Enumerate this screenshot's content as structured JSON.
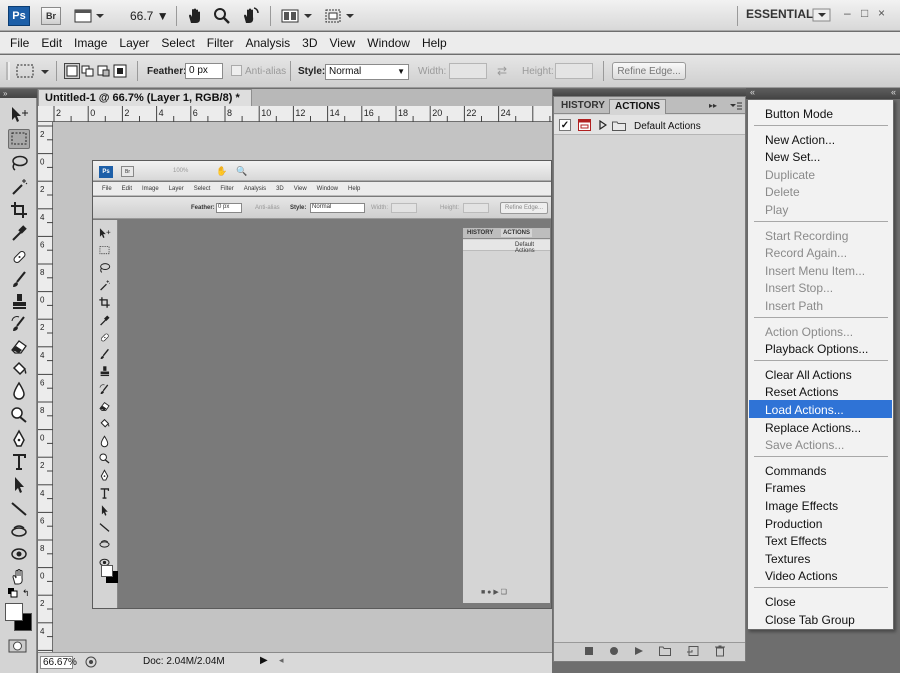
{
  "app": {
    "ps_label": "Ps",
    "br_label": "Br",
    "zoom_label": "66.7 ▼",
    "workspace_label": "ESSENTIALS"
  },
  "menubar": [
    "File",
    "Edit",
    "Image",
    "Layer",
    "Select",
    "Filter",
    "Analysis",
    "3D",
    "View",
    "Window",
    "Help"
  ],
  "options": {
    "feather_label": "Feather:",
    "feather_value": "0 px",
    "antialias_label": "Anti-alias",
    "style_label": "Style:",
    "style_value": "Normal",
    "width_label": "Width:",
    "height_label": "Height:",
    "refine_label": "Refine Edge..."
  },
  "document": {
    "tab_title": "Untitled-1 @ 66.7% (Layer 1, RGB/8) *",
    "close_glyph": "×"
  },
  "ruler_h": [
    "2",
    "0",
    "2",
    "4",
    "6",
    "8",
    "10",
    "12",
    "14",
    "16",
    "18",
    "20",
    "22",
    "24"
  ],
  "ruler_v": [
    "2",
    "0",
    "2",
    "4",
    "6",
    "8",
    "0",
    "2",
    "4",
    "6",
    "8",
    "0",
    "2",
    "4",
    "6",
    "8",
    "0",
    "2",
    "4"
  ],
  "status": {
    "zoom": "66.67%",
    "doc": "Doc: 2.04M/2.04M"
  },
  "panel": {
    "tab_history": "HISTORY",
    "tab_actions": "ACTIONS",
    "action_set": "Default Actions"
  },
  "inner": {
    "zoom": "100%",
    "menubar": [
      "File",
      "Edit",
      "Image",
      "Layer",
      "Select",
      "Filter",
      "Analysis",
      "3D",
      "View",
      "Window",
      "Help"
    ],
    "feather_label": "Feather:",
    "feather_value": "0 px",
    "antialias_label": "Anti-alias",
    "style_label": "Style:",
    "style_value": "Normal",
    "width_label": "Width:",
    "height_label": "Height:",
    "refine_label": "Refine Edge...",
    "tab_history": "HISTORY",
    "tab_actions": "ACTIONS",
    "action_set": "Default Actions"
  },
  "menu": {
    "groups": [
      [
        {
          "label": "Button Mode",
          "enabled": true
        }
      ],
      [
        {
          "label": "New Action...",
          "enabled": true
        },
        {
          "label": "New Set...",
          "enabled": true
        },
        {
          "label": "Duplicate",
          "enabled": false
        },
        {
          "label": "Delete",
          "enabled": false
        },
        {
          "label": "Play",
          "enabled": false
        }
      ],
      [
        {
          "label": "Start Recording",
          "enabled": false
        },
        {
          "label": "Record Again...",
          "enabled": false
        },
        {
          "label": "Insert Menu Item...",
          "enabled": false
        },
        {
          "label": "Insert Stop...",
          "enabled": false
        },
        {
          "label": "Insert Path",
          "enabled": false
        }
      ],
      [
        {
          "label": "Action Options...",
          "enabled": false
        },
        {
          "label": "Playback Options...",
          "enabled": true
        }
      ],
      [
        {
          "label": "Clear All Actions",
          "enabled": true
        },
        {
          "label": "Reset Actions",
          "enabled": true
        },
        {
          "label": "Load Actions...",
          "enabled": true,
          "highlighted": true
        },
        {
          "label": "Replace Actions...",
          "enabled": true
        },
        {
          "label": "Save Actions...",
          "enabled": false
        }
      ],
      [
        {
          "label": "Commands",
          "enabled": true
        },
        {
          "label": "Frames",
          "enabled": true
        },
        {
          "label": "Image Effects",
          "enabled": true
        },
        {
          "label": "Production",
          "enabled": true
        },
        {
          "label": "Text Effects",
          "enabled": true
        },
        {
          "label": "Textures",
          "enabled": true
        },
        {
          "label": "Video Actions",
          "enabled": true
        }
      ],
      [
        {
          "label": "Close",
          "enabled": true
        },
        {
          "label": "Close Tab Group",
          "enabled": true
        }
      ]
    ]
  },
  "colors": {
    "highlight": "#2f73d6",
    "ps_blue": "#1d5fa8"
  }
}
